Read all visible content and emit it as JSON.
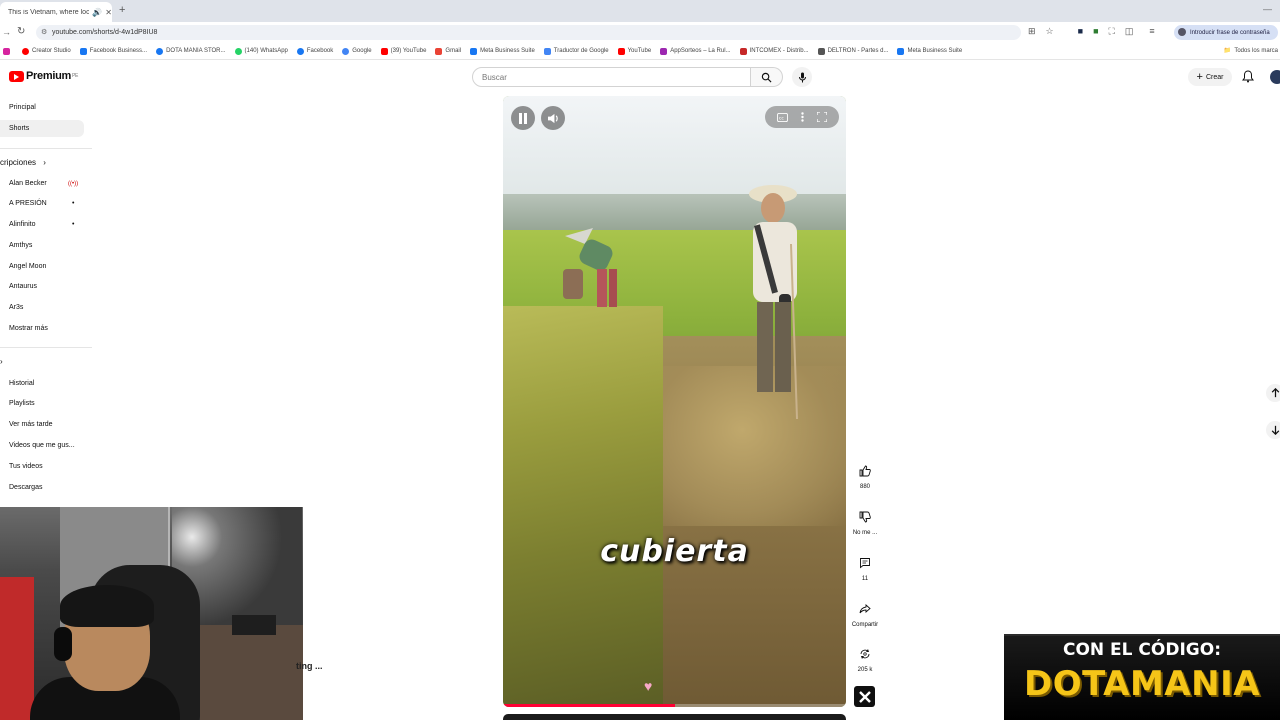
{
  "browser": {
    "tab_title": "This is Vietnam, where loca",
    "url": "youtube.com/shorts/d-4w1dP8IU8",
    "password_chip": "Introducir frase de contraseña",
    "all_bookmarks": "Todos los marca",
    "bookmarks": [
      {
        "label": "Creator Studio",
        "color": "#ff0000"
      },
      {
        "label": "Facebook Business...",
        "color": "#1877f2"
      },
      {
        "label": "DOTA MANIA STOR...",
        "color": "#1877f2"
      },
      {
        "label": "(140) WhatsApp",
        "color": "#25d366"
      },
      {
        "label": "Facebook",
        "color": "#1877f2"
      },
      {
        "label": "Google",
        "color": "#4285f4"
      },
      {
        "label": "(39) YouTube",
        "color": "#ff0000"
      },
      {
        "label": "Gmail",
        "color": "#ea4335"
      },
      {
        "label": "Meta Business Suite",
        "color": "#1877f2"
      },
      {
        "label": "Traductor de Google",
        "color": "#4285f4"
      },
      {
        "label": "YouTube",
        "color": "#ff0000"
      },
      {
        "label": "AppSorteos – La Rul...",
        "color": "#9c27b0"
      },
      {
        "label": "INTCOMEX - Distrib...",
        "color": "#c62828"
      },
      {
        "label": "DELTRON - Partes d...",
        "color": "#555555"
      },
      {
        "label": "Meta Business Suite",
        "color": "#1877f2"
      }
    ]
  },
  "youtube": {
    "logo_text": "Premium",
    "logo_sup": "PE",
    "search_placeholder": "Buscar",
    "create_label": "Crear"
  },
  "sidebar": {
    "main": [
      {
        "label": "Principal"
      },
      {
        "label": "Shorts"
      }
    ],
    "subs_header": "cripciones",
    "subscriptions": [
      {
        "label": "Alan Becker",
        "badge": "live"
      },
      {
        "label": "A PRESIÓN",
        "badge": "dot"
      },
      {
        "label": "Alinfinito",
        "badge": "dot"
      },
      {
        "label": "Amthys",
        "badge": ""
      },
      {
        "label": "Angel Moon",
        "badge": ""
      },
      {
        "label": "Antaurus",
        "badge": ""
      },
      {
        "label": "Ar3s",
        "badge": ""
      },
      {
        "label": "Mostrar más",
        "badge": ""
      }
    ],
    "you": [
      {
        "label": "Historial"
      },
      {
        "label": "Playlists"
      },
      {
        "label": "Ver más tarde"
      },
      {
        "label": "Videos que me gus..."
      },
      {
        "label": "Tus videos"
      },
      {
        "label": "Descargas"
      }
    ]
  },
  "overlay": {
    "streaming_text": "ting ..."
  },
  "short": {
    "caption": "cubierta",
    "progress_fraction": 0.5
  },
  "actions": {
    "like_count": "880",
    "dislike_label": "No me ...",
    "comments_count": "11",
    "share_label": "Compartir",
    "remix_count": "205 k"
  },
  "banner": {
    "line1": "CON EL CÓDIGO:",
    "line2": "DOTAMANIA"
  }
}
